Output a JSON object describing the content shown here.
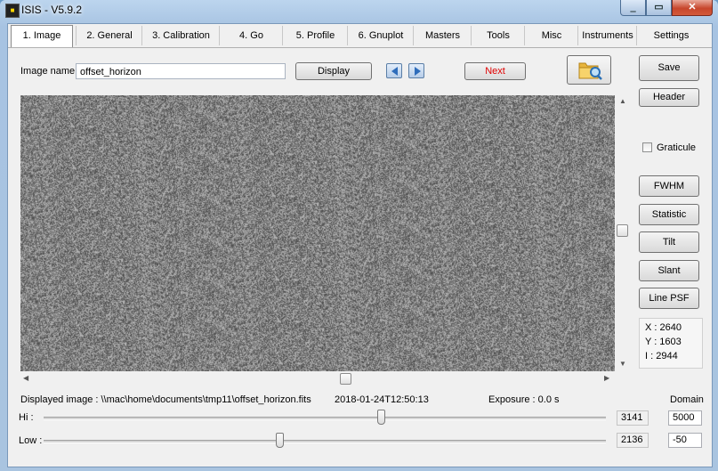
{
  "window": {
    "title": "ISIS - V5.9.2",
    "app_icon": "isis-app-icon"
  },
  "tabs": [
    "1. Image",
    "2. General",
    "3. Calibration",
    "4. Go",
    "5. Profile",
    "6. Gnuplot",
    "Masters",
    "Tools",
    "Misc",
    "Instruments",
    "Settings"
  ],
  "active_tab": "1. Image",
  "image_name": {
    "label": "Image name :",
    "value": "offset_horizon"
  },
  "buttons": {
    "display": "Display",
    "next": "Next",
    "save": "Save",
    "header": "Header",
    "fwhm": "FWHM",
    "statistic": "Statistic",
    "tilt": "Tilt",
    "slant": "Slant",
    "line_psf": "Line PSF"
  },
  "graticule": {
    "label": "Graticule",
    "checked": false
  },
  "coords": {
    "x": "X : 2640",
    "y": "Y : 1603",
    "i": "I : 2944"
  },
  "status": {
    "displayed_image": "Displayed image : \\\\mac\\home\\documents\\tmp11\\offset_horizon.fits",
    "timestamp": "2018-01-24T12:50:13",
    "exposure": "Exposure : 0.0 s",
    "domain_label": "Domain"
  },
  "levels": {
    "hi": {
      "label": "Hi :",
      "value": "3141",
      "domain": "5000",
      "fraction": 0.6
    },
    "low": {
      "label": "Low :",
      "value": "2136",
      "domain": "-50",
      "fraction": 0.42
    }
  },
  "colors": {
    "next_text": "#e00000",
    "nav_arrow": "#2f6dbb",
    "image_noise_base": "#777777"
  }
}
